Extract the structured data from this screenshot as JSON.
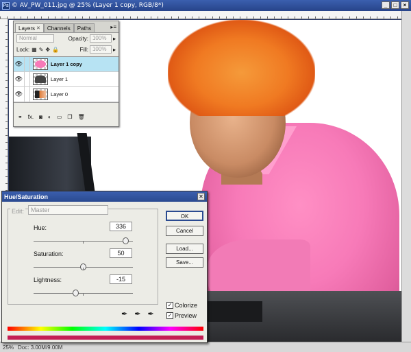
{
  "document": {
    "title": "© AV_PW_011.jpg @ 25% (Layer 1 copy, RGB/8*)",
    "window_buttons": [
      "_",
      "□",
      "×"
    ],
    "status_zoom": "25%",
    "status_info": "Doc: 3.00M/9.00M"
  },
  "layers_panel": {
    "tabs": [
      "Layers",
      "Channels",
      "Paths"
    ],
    "active_tab": "Layers",
    "blend_mode": "Normal",
    "opacity_label": "Opacity:",
    "opacity_value": "100%",
    "lock_label": "Lock:",
    "fill_label": "Fill:",
    "fill_value": "100%",
    "layers": [
      {
        "name": "Layer 1 copy",
        "selected": true,
        "thumb_color": "#f77ab8"
      },
      {
        "name": "Layer 1",
        "selected": false,
        "thumb_color": "#444444"
      },
      {
        "name": "Layer 0",
        "selected": false,
        "thumb_color": "#e07a35"
      }
    ],
    "footer_icons": [
      "link-icon",
      "fx-icon",
      "mask-icon",
      "adjustment-icon",
      "group-icon",
      "new-layer-icon",
      "trash-icon"
    ],
    "fx_label": "fx."
  },
  "hue_saturation": {
    "title": "Hue/Saturation",
    "edit_label": "Edit:",
    "edit_value": "Master",
    "hue_label": "Hue:",
    "hue_value": "336",
    "hue_fraction": 0.933,
    "saturation_label": "Saturation:",
    "saturation_value": "50",
    "saturation_fraction": 0.5,
    "lightness_label": "Lightness:",
    "lightness_value": "-15",
    "lightness_fraction": 0.425,
    "buttons": {
      "ok": "OK",
      "cancel": "Cancel",
      "load": "Load...",
      "save": "Save..."
    },
    "colorize_label": "Colorize",
    "colorize_checked": true,
    "preview_label": "Preview",
    "preview_checked": true,
    "colors": {
      "result_bar": "#c41e55",
      "title_bar": "#2a4a90"
    }
  }
}
